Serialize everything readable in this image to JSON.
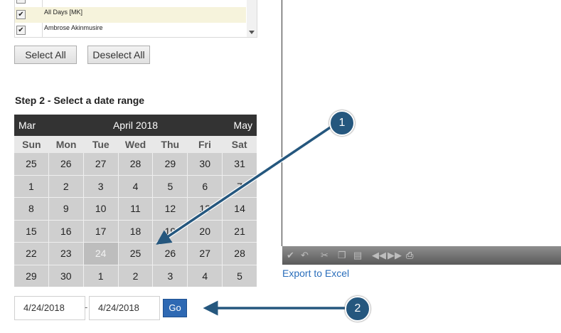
{
  "artist_list": {
    "items": [
      {
        "label": "",
        "checked": true
      },
      {
        "label": "All Days [MK]",
        "checked": true,
        "highlighted": true
      },
      {
        "label": "Ambrose Akinmusire",
        "checked": true
      }
    ]
  },
  "buttons": {
    "select_all": "Select All",
    "deselect_all": "Deselect All"
  },
  "step2_heading": "Step 2 - Select a date range",
  "calendar": {
    "prev": "Mar",
    "title": "April 2018",
    "next": "May",
    "weekdays": [
      "Sun",
      "Mon",
      "Tue",
      "Wed",
      "Thu",
      "Fri",
      "Sat"
    ],
    "weeks": [
      [
        "25",
        "26",
        "27",
        "28",
        "29",
        "30",
        "31"
      ],
      [
        "1",
        "2",
        "3",
        "4",
        "5",
        "6",
        "7"
      ],
      [
        "8",
        "9",
        "10",
        "11",
        "12",
        "13",
        "14"
      ],
      [
        "15",
        "16",
        "17",
        "18",
        "19",
        "20",
        "21"
      ],
      [
        "22",
        "23",
        "24",
        "25",
        "26",
        "27",
        "28"
      ],
      [
        "29",
        "30",
        "1",
        "2",
        "3",
        "4",
        "5"
      ]
    ],
    "selected_day": "24"
  },
  "date_range": {
    "start": "4/24/2018",
    "separator": "-",
    "end": "4/24/2018",
    "go": "Go"
  },
  "report_viewer": {
    "toolbar_icons": [
      "check-icon",
      "undo-icon",
      "cut-icon",
      "copy-icon",
      "paste-icon",
      "first-page-icon",
      "next-page-icon",
      "print-icon"
    ]
  },
  "export_link": "Export to Excel",
  "callouts": [
    "1",
    "2"
  ],
  "colors": {
    "calendar_header": "#333333",
    "calendar_cell": "#cfcfcf",
    "go_button": "#2e69b3",
    "link": "#2a6ebb",
    "callout": "#25577e"
  }
}
